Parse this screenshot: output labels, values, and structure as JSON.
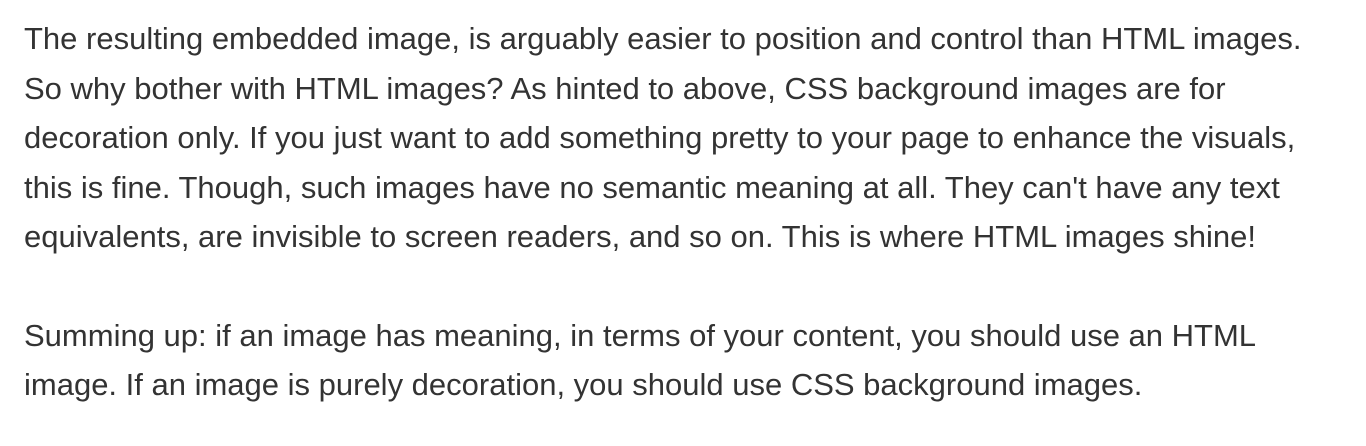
{
  "article": {
    "paragraph_1": [
      "The resulting embedded image, is arguably easier to position and control than HTML images.",
      "So why bother with HTML images? As hinted to above, CSS background images are for",
      "decoration only. If you just want to add something pretty to your page to enhance the visuals,",
      "this is fine. Though, such images have no semantic meaning at all. They can't have any text",
      "equivalents, are invisible to screen readers, and so on. This is where HTML images shine!"
    ],
    "paragraph_2": [
      "Summing up: if an image has meaning, in terms of your content, you should use an HTML",
      "image. If an image is purely decoration, you should use CSS background images."
    ]
  }
}
